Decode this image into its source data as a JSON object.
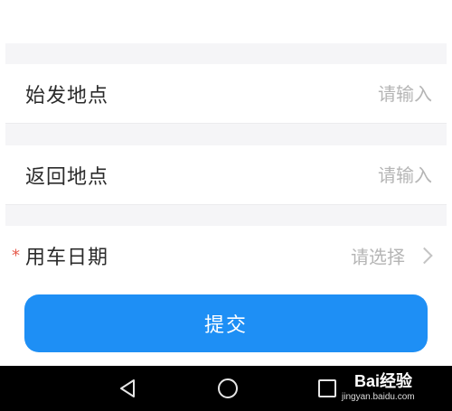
{
  "form": {
    "rows": [
      {
        "label": "始发地点",
        "placeholder": "请输入"
      },
      {
        "label": "返回地点",
        "placeholder": "请输入"
      }
    ],
    "date_row": {
      "required_mark": "*",
      "label": "用车日期",
      "select_value": "请选择"
    },
    "submit_label": "提交"
  },
  "colors": {
    "primary": "#1e8ff5",
    "required": "#e65a4b",
    "placeholder": "#b5b5b5",
    "background": "#f5f5f7"
  },
  "nav_bar": {
    "icons": [
      "back-triangle-icon",
      "home-circle-icon",
      "recent-square-icon"
    ]
  },
  "watermark": {
    "brand": "Bai经验",
    "url": "jingyan.baidu.com"
  }
}
